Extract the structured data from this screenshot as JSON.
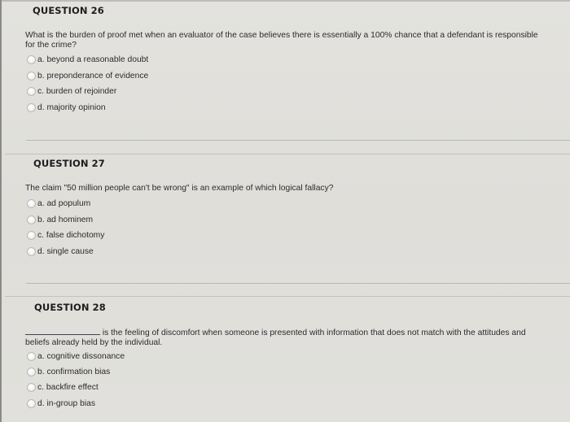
{
  "questions": [
    {
      "heading": "QUESTION 26",
      "text": "What is the burden of proof met when an evaluator of the case believes there is essentially a 100% chance that a defendant is responsible for the crime?",
      "text_line1": "What is the burden of proof met when an evaluator of the case believes there is essentially a 100% chance that a defendant is responsible",
      "text_line2": "for the crime?",
      "options": [
        {
          "label": "a. beyond a reasonable doubt",
          "selected": false
        },
        {
          "label": "b. preponderance of evidence",
          "selected": false
        },
        {
          "label": "c. burden of rejoinder",
          "selected": false
        },
        {
          "label": "d. majority opinion",
          "selected": false
        }
      ]
    },
    {
      "heading": "QUESTION 27",
      "text": "The claim \"50 million people can't be wrong\" is an example of which logical fallacy?",
      "options": [
        {
          "label": "a. ad populum",
          "selected": false
        },
        {
          "label": "b. ad hominem",
          "selected": false
        },
        {
          "label": "c. false dichotomy",
          "selected": false
        },
        {
          "label": "d. single cause",
          "selected": false
        }
      ]
    },
    {
      "heading": "QUESTION 28",
      "text_line1": " is the feeling of discomfort when someone is presented with information that does not match with the attitudes and",
      "text_line2": "beliefs already held by the individual.",
      "options": [
        {
          "label": "a. cognitive dissonance",
          "selected": false
        },
        {
          "label": "b. confirmation bias",
          "selected": false
        },
        {
          "label": "c. backfire effect",
          "selected": false
        },
        {
          "label": "d. in-group bias",
          "selected": false
        }
      ]
    }
  ]
}
